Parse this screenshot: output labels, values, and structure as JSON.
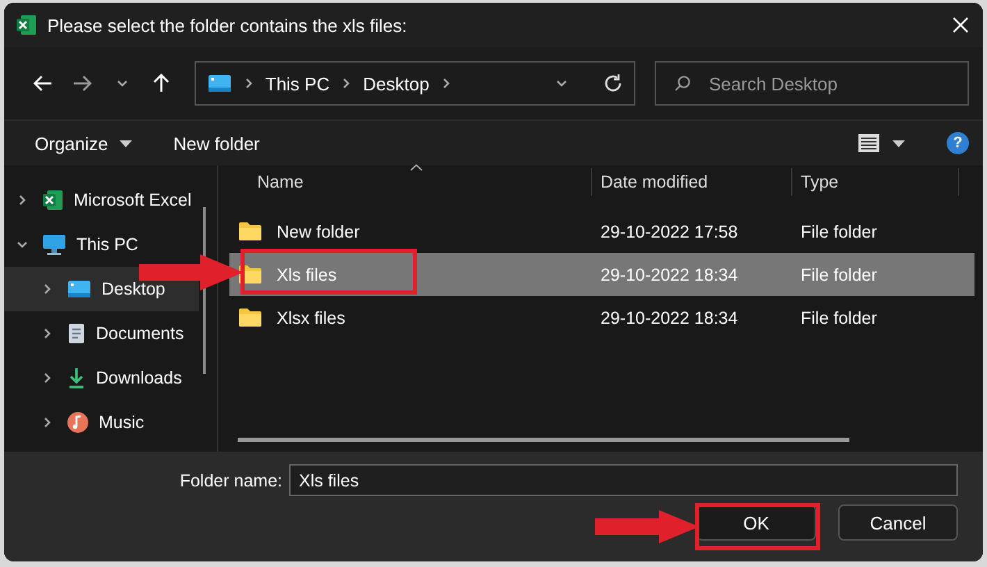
{
  "window": {
    "title": "Please select the folder contains the xls files:"
  },
  "address_bar": {
    "path": [
      "This PC",
      "Desktop"
    ]
  },
  "search": {
    "placeholder": "Search Desktop"
  },
  "command_bar": {
    "buttons": [
      "Organize",
      "New folder"
    ],
    "help_icon": "?"
  },
  "sidebar": {
    "items": [
      {
        "label": "Microsoft Excel",
        "expanded": false,
        "selected": false
      },
      {
        "label": "This PC",
        "expanded": true,
        "selected": false,
        "children": [
          {
            "label": "Desktop",
            "expanded": false,
            "selected": true
          },
          {
            "label": "Documents",
            "expanded": false,
            "selected": false
          },
          {
            "label": "Downloads",
            "expanded": false,
            "selected": false
          },
          {
            "label": "Music",
            "expanded": false,
            "selected": false
          }
        ]
      }
    ]
  },
  "file_list": {
    "columns": [
      "Name",
      "Date modified",
      "Type"
    ],
    "rows": [
      {
        "name": "New folder",
        "date_modified": "29-10-2022 17:58",
        "type": "File folder",
        "selected": false
      },
      {
        "name": "Xls files",
        "date_modified": "29-10-2022 18:34",
        "type": "File folder",
        "selected": true
      },
      {
        "name": "Xlsx files",
        "date_modified": "29-10-2022 18:34",
        "type": "File folder",
        "selected": false
      }
    ]
  },
  "footer": {
    "folder_name_label": "Folder name:",
    "folder_name_value": "Xls files",
    "buttons": [
      "OK",
      "Cancel"
    ]
  }
}
